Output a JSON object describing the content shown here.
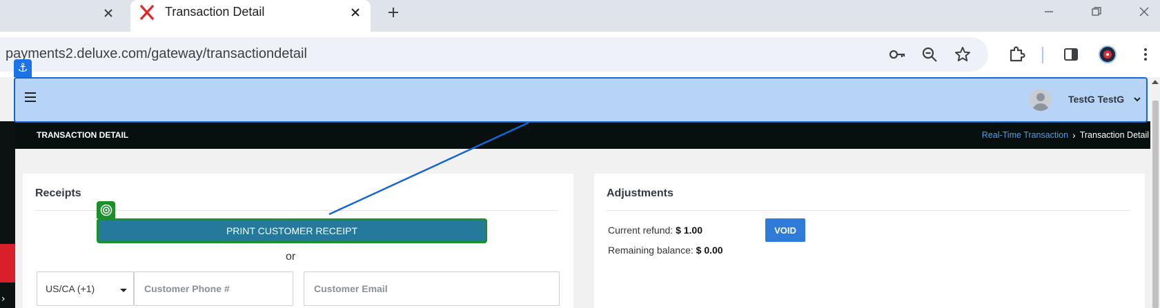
{
  "browser": {
    "tab_title": "Transaction Detail",
    "url": "payments2.deluxe.com/gateway/transactiondetail"
  },
  "appbar": {
    "user_name": "TestG TestG"
  },
  "page_header": {
    "title": "TRANSACTION DETAIL",
    "breadcrumb": {
      "link": "Real-Time Transaction",
      "current": "Transaction Detail"
    }
  },
  "receipts": {
    "title": "Receipts",
    "print_button": "PRINT CUSTOMER RECEIPT",
    "or_label": "or",
    "country_code": "US/CA (+1)",
    "phone_placeholder": "Customer Phone #",
    "email_placeholder": "Customer Email"
  },
  "adjustments": {
    "title": "Adjustments",
    "current_refund_label": "Current refund:",
    "current_refund_value": "$ 1.00",
    "remaining_balance_label": "Remaining balance:",
    "remaining_balance_value": "$ 0.00",
    "void_button": "VOID"
  },
  "colors": {
    "appbar": "#b7d3f5",
    "annotation_blue": "#1565d8",
    "annotation_green": "#1a8f2a",
    "print_button": "#257a9b",
    "void_button": "#2f7bd9",
    "breadcrumb_link": "#4a9fea"
  }
}
